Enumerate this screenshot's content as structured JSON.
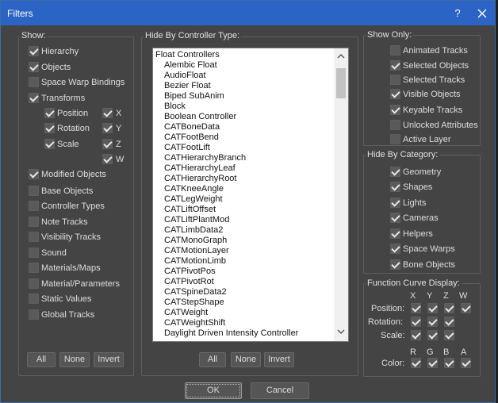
{
  "window": {
    "title": "Filters",
    "help_label": "?"
  },
  "show": {
    "title": "Show:",
    "items": [
      {
        "label": "Hierarchy",
        "checked": true
      },
      {
        "label": "Objects",
        "checked": true
      },
      {
        "label": "Space Warp Bindings",
        "checked": false
      },
      {
        "label": "Transforms",
        "checked": true
      },
      {
        "label": "Position",
        "checked": true
      },
      {
        "label": "Rotation",
        "checked": true
      },
      {
        "label": "Scale",
        "checked": true
      },
      {
        "label": "X",
        "checked": true
      },
      {
        "label": "Y",
        "checked": true
      },
      {
        "label": "Z",
        "checked": true
      },
      {
        "label": "W",
        "checked": true
      },
      {
        "label": "Modified Objects",
        "checked": true
      },
      {
        "label": "Base Objects",
        "checked": false
      },
      {
        "label": "Controller Types",
        "checked": false
      },
      {
        "label": "Note Tracks",
        "checked": false
      },
      {
        "label": "Visibility Tracks",
        "checked": false
      },
      {
        "label": "Sound",
        "checked": false
      },
      {
        "label": "Materials/Maps",
        "checked": false
      },
      {
        "label": "Material/Parameters",
        "checked": false
      },
      {
        "label": "Static Values",
        "checked": false
      },
      {
        "label": "Global Tracks",
        "checked": false
      }
    ],
    "buttons": {
      "all": "All",
      "none": "None",
      "invert": "Invert"
    }
  },
  "hide_by_controller": {
    "title": "Hide By Controller Type:",
    "items": [
      "Float Controllers",
      "Alembic Float",
      "AudioFloat",
      "Bezier Float",
      "Biped SubAnim",
      "Block",
      "Boolean Controller",
      "CATBoneData",
      "CATFootBend",
      "CATFootLift",
      "CATHierarchyBranch",
      "CATHierarchyLeaf",
      "CATHierarchyRoot",
      "CATKneeAngle",
      "CATLegWeight",
      "CATLiftOffset",
      "CATLiftPlantMod",
      "CATLimbData2",
      "CATMonoGraph",
      "CATMotionLayer",
      "CATMotionLimb",
      "CATPivotPos",
      "CATPivotRot",
      "CATSpineData2",
      "CATStepShape",
      "CATWeight",
      "CATWeightShift",
      "Daylight Driven Intensity Controller"
    ],
    "buttons": {
      "all": "All",
      "none": "None",
      "invert": "Invert"
    }
  },
  "show_only": {
    "title": "Show Only:",
    "items": [
      {
        "label": "Animated Tracks",
        "checked": false
      },
      {
        "label": "Selected Objects",
        "checked": true
      },
      {
        "label": "Selected Tracks",
        "checked": false
      },
      {
        "label": "Visible Objects",
        "checked": true
      },
      {
        "label": "Keyable Tracks",
        "checked": true
      },
      {
        "label": "Unlocked Attributes",
        "checked": false
      },
      {
        "label": "Active Layer",
        "checked": false
      }
    ]
  },
  "hide_by_category": {
    "title": "Hide By Category:",
    "items": [
      {
        "label": "Geometry",
        "checked": true
      },
      {
        "label": "Shapes",
        "checked": true
      },
      {
        "label": "Lights",
        "checked": true
      },
      {
        "label": "Cameras",
        "checked": true
      },
      {
        "label": "Helpers",
        "checked": true
      },
      {
        "label": "Space Warps",
        "checked": true
      },
      {
        "label": "Bone Objects",
        "checked": true
      }
    ]
  },
  "function_curve": {
    "title": "Function Curve Display:",
    "cols_xyzw": [
      "X",
      "Y",
      "Z",
      "W"
    ],
    "cols_rgba": [
      "R",
      "G",
      "B",
      "A"
    ],
    "rows": [
      {
        "label": "Position:",
        "checks": [
          true,
          true,
          true,
          true
        ]
      },
      {
        "label": "Rotation:",
        "checks": [
          true,
          true,
          true
        ]
      },
      {
        "label": "Scale:",
        "checks": [
          true,
          true,
          true
        ]
      },
      {
        "label": "Color:",
        "checks": [
          true,
          true,
          true,
          true
        ]
      }
    ]
  },
  "footer": {
    "ok": "OK",
    "cancel": "Cancel"
  }
}
